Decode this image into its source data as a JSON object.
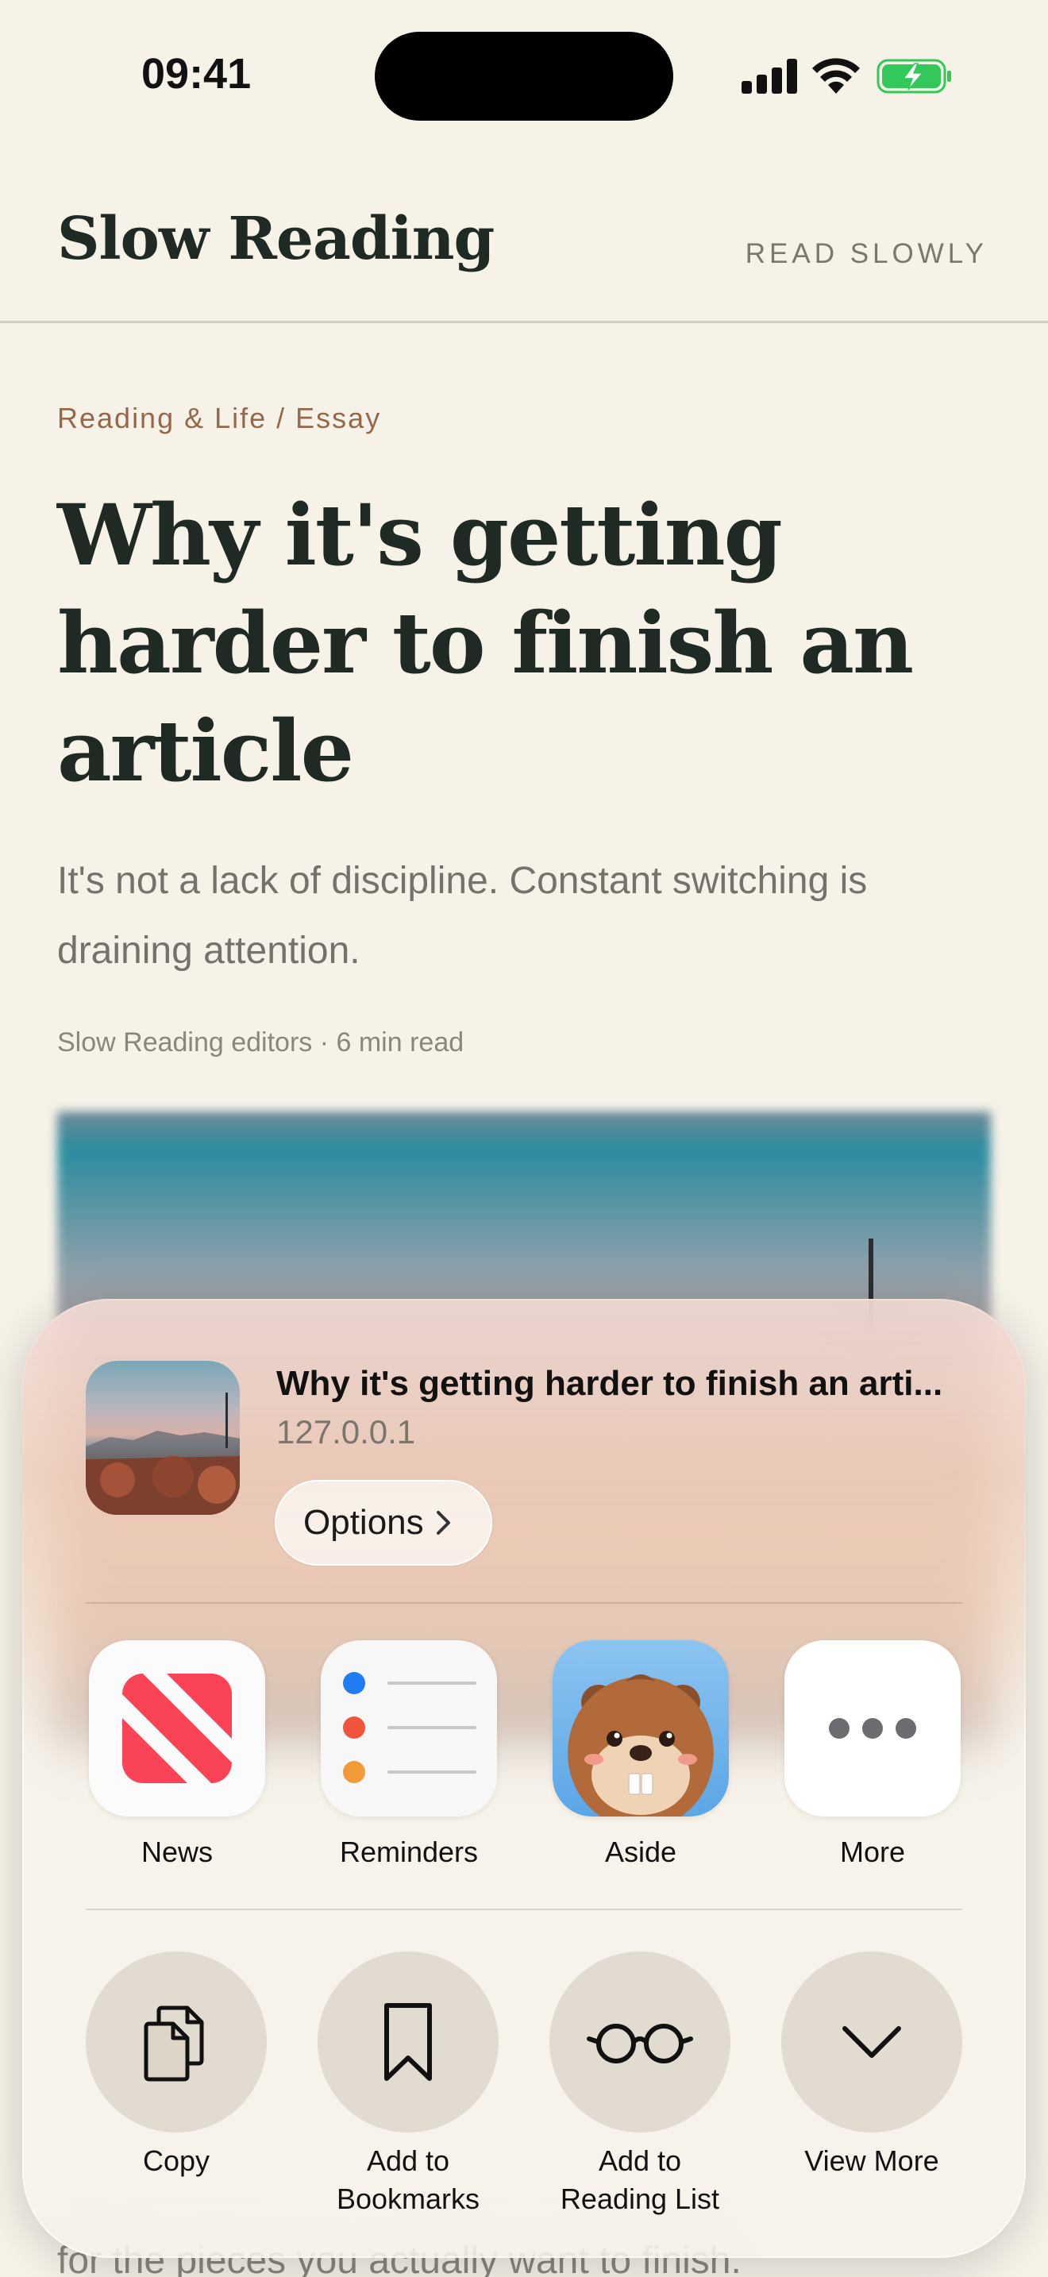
{
  "status_bar": {
    "time": "09:41"
  },
  "site": {
    "brand": "Slow Reading",
    "tagline": "READ SLOWLY"
  },
  "article": {
    "category": "Reading & Life / Essay",
    "title": "Why it's getting harder to finish an article",
    "dek": "It's not a lack of discipline. Constant switching is draining attention.",
    "byline": "Slow Reading editors · 6 min read",
    "body_visible": "for the pieces you actually want to finish."
  },
  "share_sheet": {
    "title": "Why it's getting harder to finish an arti...",
    "url": "127.0.0.1",
    "options_label": "Options",
    "apps": [
      {
        "label": "News",
        "icon": "news-icon"
      },
      {
        "label": "Reminders",
        "icon": "reminders-icon"
      },
      {
        "label": "Aside",
        "icon": "aside-beaver-icon"
      },
      {
        "label": "More",
        "icon": "more-dots-icon"
      }
    ],
    "actions": [
      {
        "line1": "Copy",
        "line2": "",
        "icon": "copy-icon"
      },
      {
        "line1": "Add to",
        "line2": "Bookmarks",
        "icon": "bookmark-icon"
      },
      {
        "line1": "Add to",
        "line2": "Reading List",
        "icon": "glasses-icon"
      },
      {
        "line1": "View More",
        "line2": "",
        "icon": "chevron-down-icon"
      }
    ]
  },
  "colors": {
    "background": "#f6f2e8",
    "brand_text": "#1f2a25",
    "category": "#96684a",
    "news_red": "#fb4358",
    "battery_green": "#34c759"
  }
}
